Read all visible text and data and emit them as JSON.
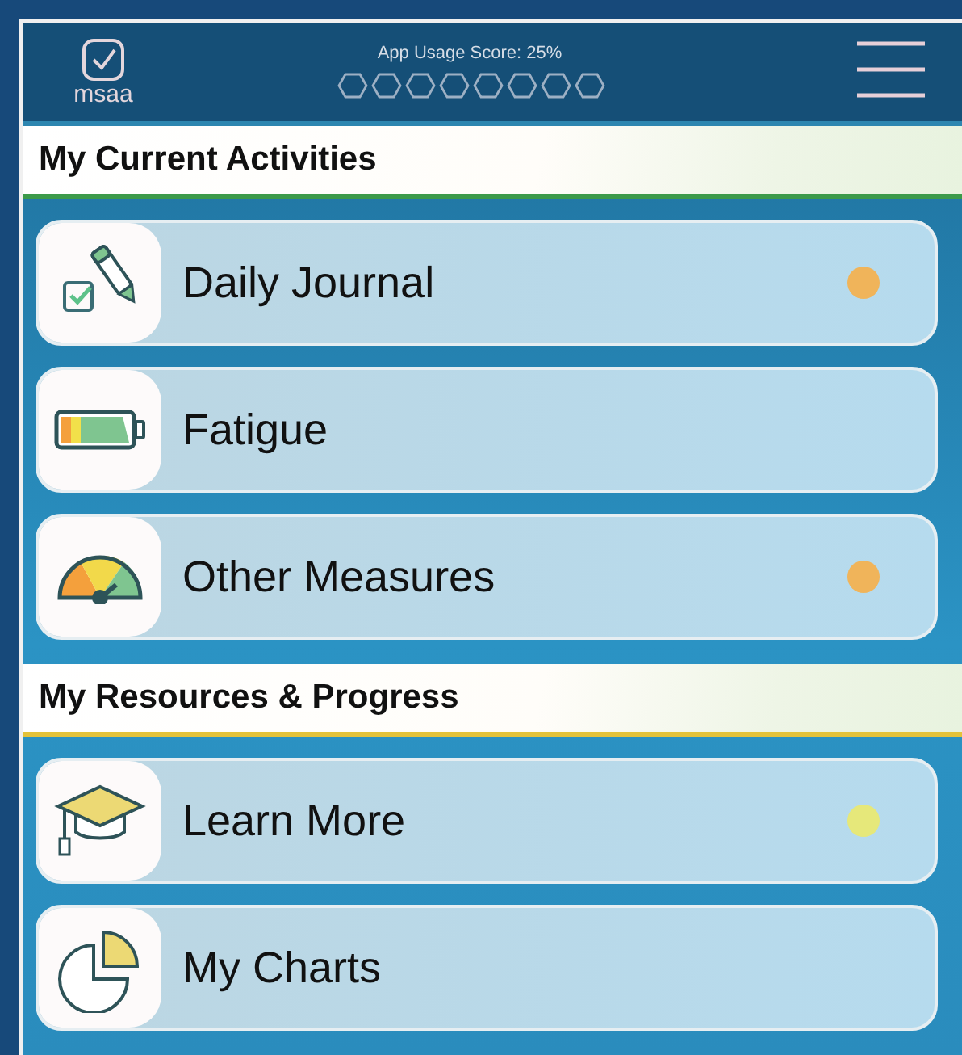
{
  "header": {
    "logo_text": "msaa",
    "score_label": "App Usage Score: 25%"
  },
  "sections": [
    {
      "title": "My Current Activities",
      "items": [
        {
          "label": "Daily Journal",
          "color": "#f0b45a"
        },
        {
          "label": "Fatigue"
        },
        {
          "label": "Other Measures",
          "color": "#f0b45a"
        }
      ]
    },
    {
      "title": "My Resources & Progress",
      "items": [
        {
          "label": "Learn More",
          "color": "#e6e87a"
        },
        {
          "label": "My Charts"
        }
      ]
    }
  ]
}
